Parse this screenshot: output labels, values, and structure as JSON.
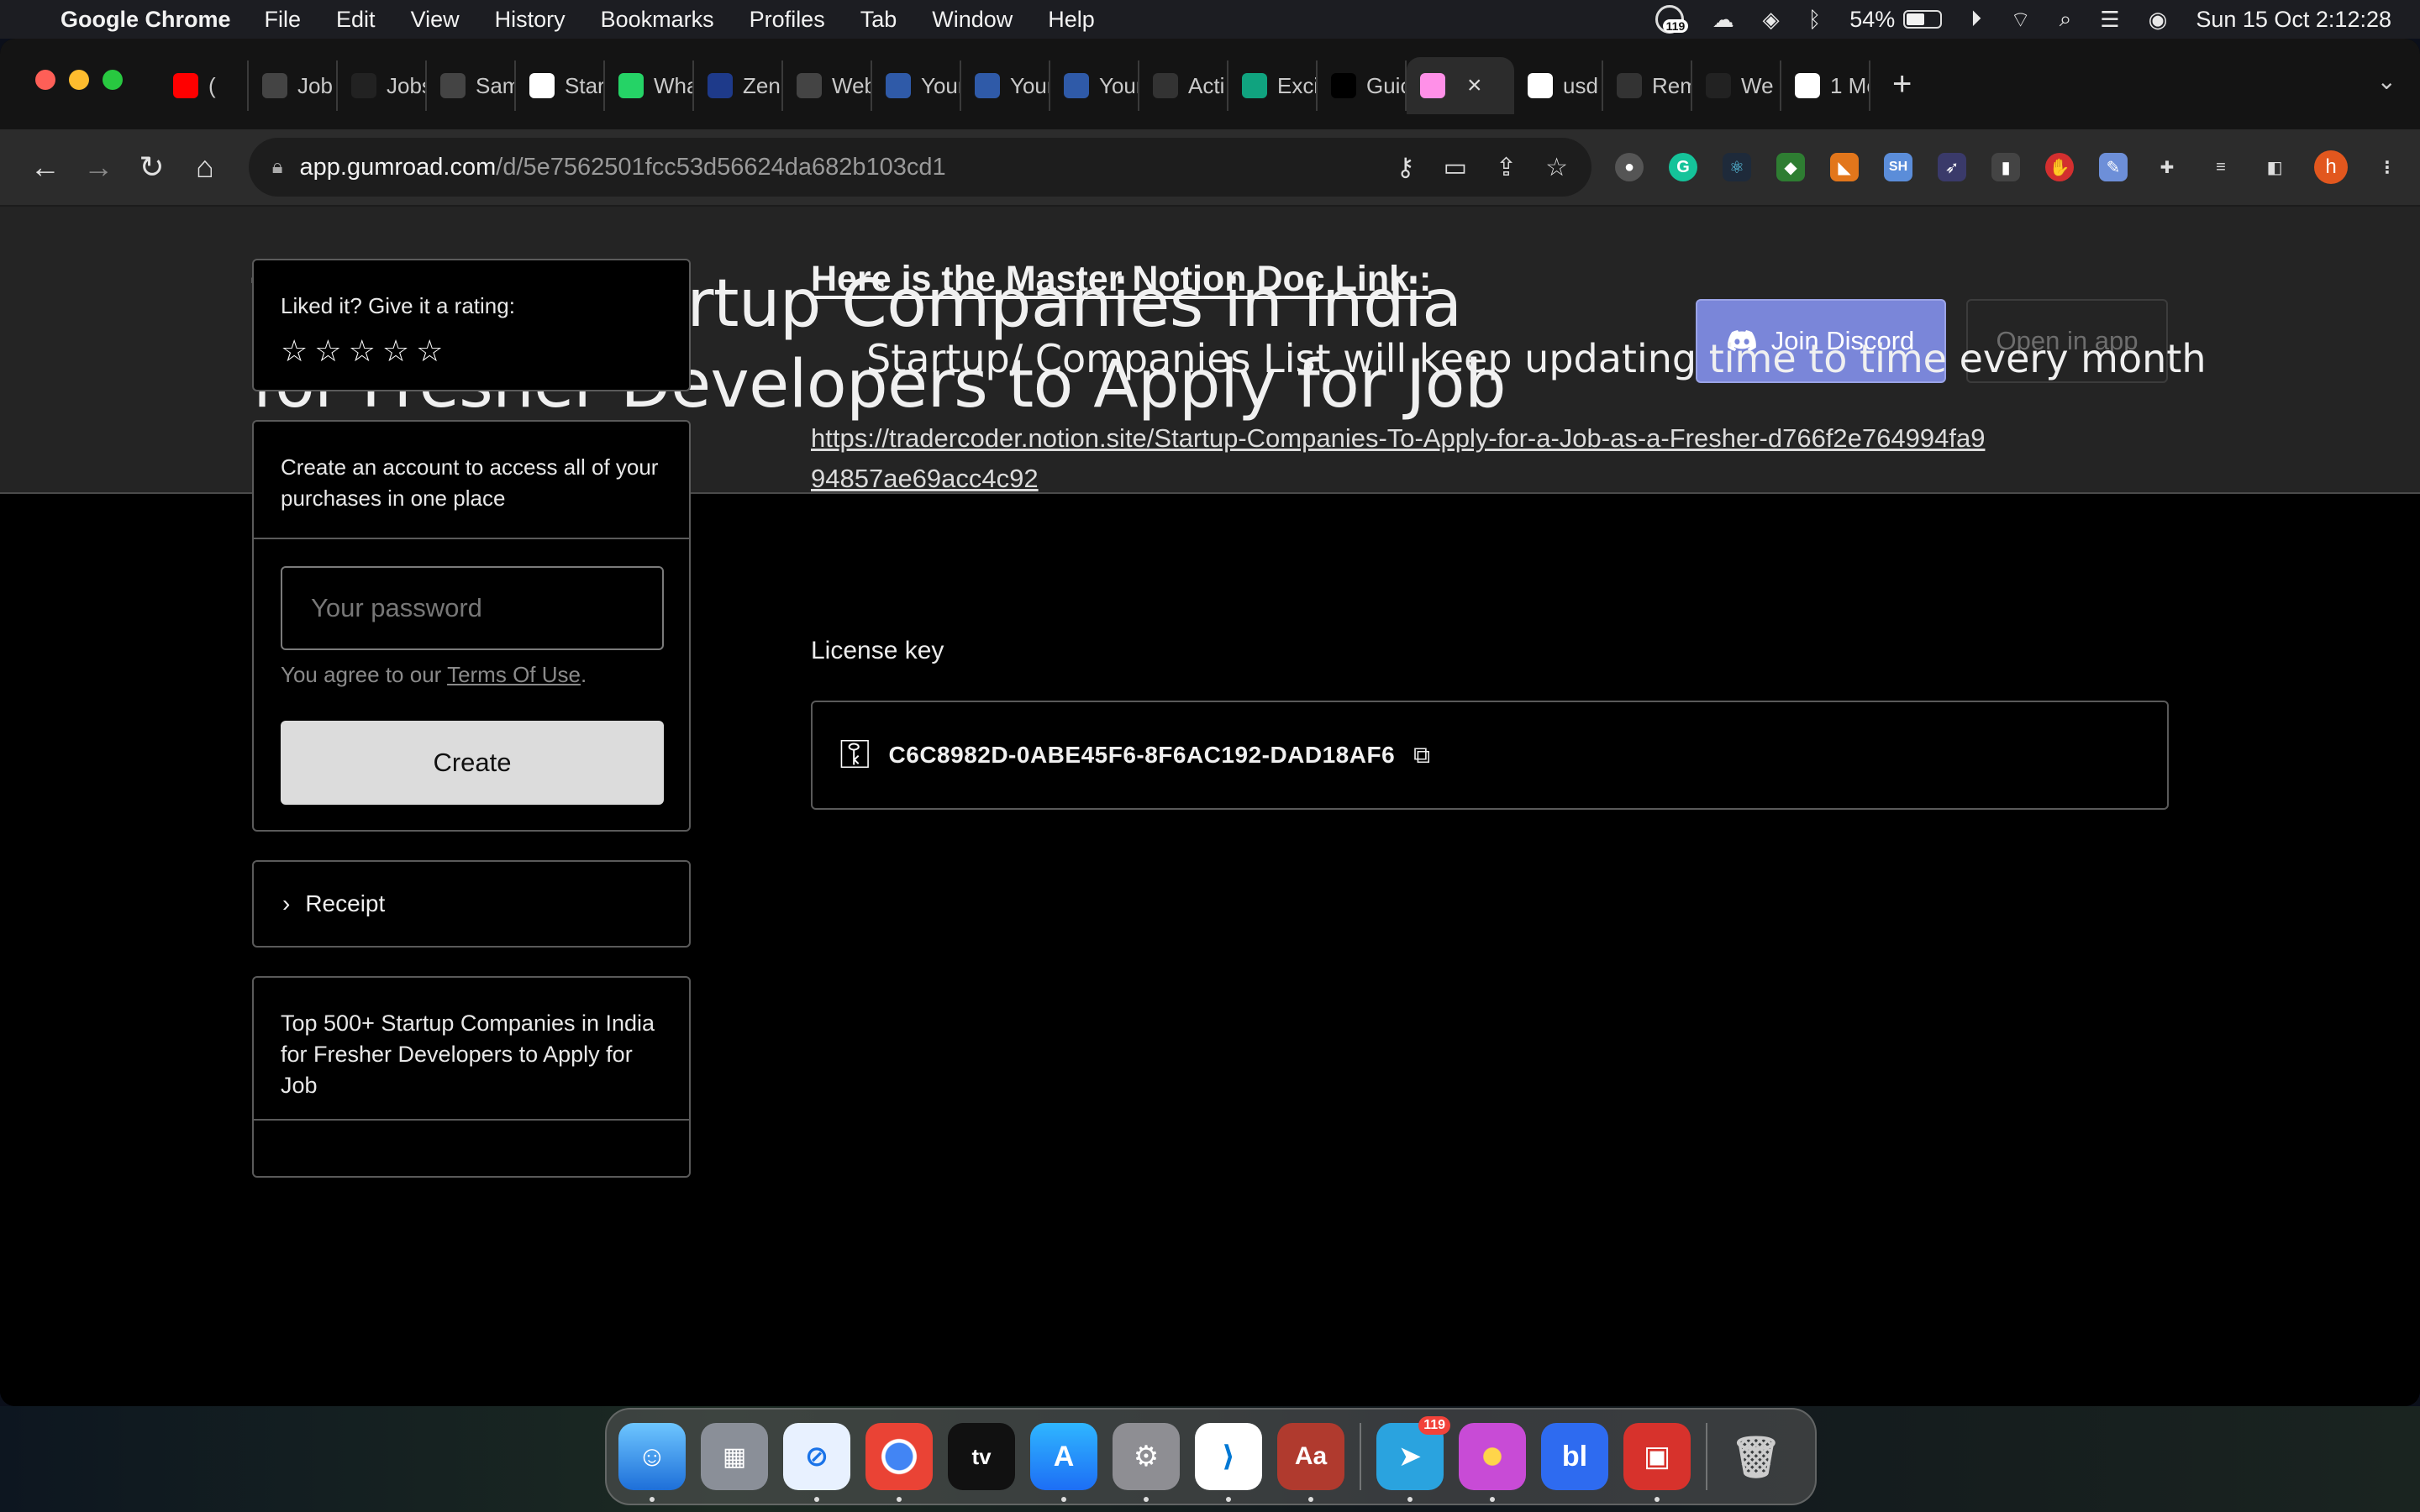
{
  "menubar": {
    "app_name": "Google Chrome",
    "items": [
      "File",
      "Edit",
      "View",
      "History",
      "Bookmarks",
      "Profiles",
      "Tab",
      "Window",
      "Help"
    ],
    "notification_count": "119",
    "battery_percent": "54%",
    "battery_level": 0.54,
    "datetime": "Sun 15 Oct  2:12:28"
  },
  "tabs": [
    {
      "label": "(",
      "favicon": "youtube-icon",
      "color": "#ff0000"
    },
    {
      "label": "Job",
      "favicon": "info-icon",
      "color": "#444"
    },
    {
      "label": "Jobs",
      "favicon": "rt-icon",
      "color": "#222"
    },
    {
      "label": "Sam",
      "favicon": "info-icon",
      "color": "#444"
    },
    {
      "label": "Star",
      "favicon": "w-icon",
      "color": "#fff"
    },
    {
      "label": "Wha",
      "favicon": "whatsapp-icon",
      "color": "#25d366"
    },
    {
      "label": "Zen",
      "favicon": "zen-icon",
      "color": "#1e3a8a"
    },
    {
      "label": "Web",
      "favicon": "info-icon",
      "color": "#444"
    },
    {
      "label": "Your",
      "favicon": "doc-icon",
      "color": "#2f5aa8"
    },
    {
      "label": "Your",
      "favicon": "doc-icon",
      "color": "#2f5aa8"
    },
    {
      "label": "Your",
      "favicon": "doc-icon",
      "color": "#2f5aa8"
    },
    {
      "label": "Acti",
      "favicon": "ih-icon",
      "color": "#333"
    },
    {
      "label": "Exci",
      "favicon": "openai-icon",
      "color": "#10a37f"
    },
    {
      "label": "Guic",
      "favicon": "medium-icon",
      "color": "#000"
    },
    {
      "label": "",
      "favicon": "gumroad-icon",
      "color": "#ff90e8",
      "active": true
    },
    {
      "label": "usd",
      "favicon": "google-icon",
      "color": "#fff"
    },
    {
      "label": "Rem",
      "favicon": "r-icon",
      "color": "#333"
    },
    {
      "label": "We",
      "favicon": "wwf-icon",
      "color": "#222"
    },
    {
      "label": "1 Mo",
      "favicon": "p-icon",
      "color": "#fff"
    }
  ],
  "address_bar": {
    "host": "app.gumroad.com",
    "path": "/d/5e7562501fcc53d56624da682b103cd1"
  },
  "profile_initial": "h",
  "hero": {
    "title": "Top 500+ Startup Companies in India for Fresher Developers to Apply for Job",
    "discord_label": "Join Discord",
    "open_app_label": "Open in app"
  },
  "sidebar": {
    "rating_prompt": "Liked it? Give it a rating:",
    "rating_stars": 5,
    "rating_value": 0,
    "account_prompt": "Create an account to access all of your purchases in one place",
    "password_placeholder": "Your password",
    "terms_prefix": "You agree to our ",
    "terms_link": "Terms Of Use",
    "terms_suffix": ".",
    "create_label": "Create",
    "receipt_label": "Receipt",
    "product_title": "Top 500+ Startup Companies in India for Fresher Developers to Apply for Job"
  },
  "content": {
    "heading": "Here is the Master Notion Doc Link :",
    "update_note": "Startup/ Companies List will keep updating time to time every month",
    "notion_link": "https://tradercoder.notion.site/Startup-Companies-To-Apply-for-a-Job-as-a-Fresher-d766f2e764994fa994857ae69acc4c92",
    "license_label": "License key",
    "license_key": "C6C8982D-0ABE45F6-8F6AC192-DAD18AF6"
  },
  "dock": {
    "telegram_badge": "119"
  },
  "colors": {
    "discord_button": "#7a86d9",
    "hero_bg": "#242424",
    "page_bg": "#000000",
    "create_button": "#dcdcdc"
  }
}
